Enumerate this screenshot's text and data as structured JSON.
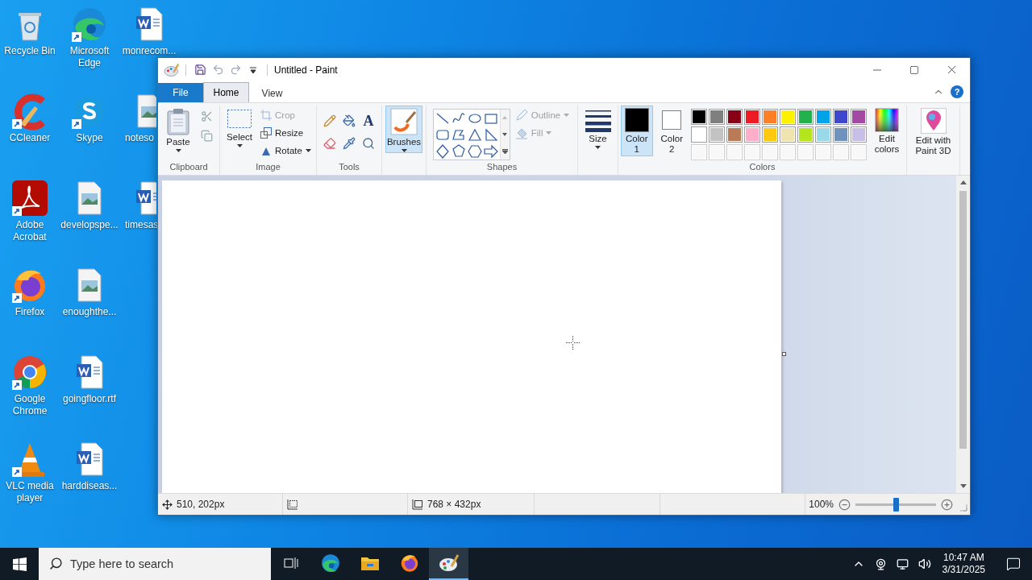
{
  "desktop": {
    "columns": [
      [
        {
          "label": "Recycle Bin",
          "kind": "recycle",
          "shortcut": false
        },
        {
          "label": "CCleaner",
          "kind": "ccleaner",
          "shortcut": true
        },
        {
          "label": "Adobe Acrobat",
          "kind": "acrobat",
          "shortcut": true
        },
        {
          "label": "Firefox",
          "kind": "firefox",
          "shortcut": true
        },
        {
          "label": "Google Chrome",
          "kind": "chrome",
          "shortcut": true
        },
        {
          "label": "VLC media player",
          "kind": "vlc",
          "shortcut": true
        }
      ],
      [
        {
          "label": "Microsoft Edge",
          "kind": "edge",
          "shortcut": true
        },
        {
          "label": "Skype",
          "kind": "skype",
          "shortcut": true
        },
        {
          "label": "developspe...",
          "kind": "image",
          "shortcut": false
        },
        {
          "label": "enoughthe...",
          "kind": "image",
          "shortcut": false
        },
        {
          "label": "goingfloor.rtf",
          "kind": "word",
          "shortcut": false
        },
        {
          "label": "harddiseas...",
          "kind": "word",
          "shortcut": false
        }
      ],
      [
        {
          "label": "monrecom...",
          "kind": "word",
          "shortcut": false
        },
        {
          "label": "noteso",
          "kind": "image",
          "shortcut": false
        },
        {
          "label": "timesas",
          "kind": "word",
          "shortcut": false
        }
      ]
    ]
  },
  "window": {
    "title": "Untitled - Paint",
    "help_glyph": "?"
  },
  "ribbon": {
    "tabs": [
      {
        "label": "File",
        "kind": "file"
      },
      {
        "label": "Home",
        "kind": "tab",
        "selected": true
      },
      {
        "label": "View",
        "kind": "tab",
        "selected": false
      }
    ],
    "clipboard": {
      "paste": "Paste",
      "label": "Clipboard"
    },
    "image": {
      "select": "Select",
      "crop": {
        "label": "Crop",
        "disabled": true
      },
      "resize": {
        "label": "Resize",
        "disabled": false
      },
      "rotate": {
        "label": "Rotate",
        "disabled": false
      },
      "label": "Image"
    },
    "tools": {
      "text_glyph": "A",
      "label": "Tools"
    },
    "brushes": {
      "label": "Brushes",
      "selected": true
    },
    "shapes": {
      "label": "Shapes",
      "outline": {
        "label": "Outline",
        "disabled": true
      },
      "fill": {
        "label": "Fill",
        "disabled": true
      }
    },
    "size": {
      "label": "Size"
    },
    "colors": {
      "label": "Colors",
      "color1": {
        "label": "Color 1",
        "color": "#000000",
        "selected": true
      },
      "color2": {
        "label": "Color 2",
        "color": "#ffffff",
        "selected": false
      },
      "palette": [
        {
          "kind": "swatch",
          "color": "#000000"
        },
        {
          "kind": "swatch",
          "color": "#7f7f7f"
        },
        {
          "kind": "swatch",
          "color": "#880015"
        },
        {
          "kind": "swatch",
          "color": "#ed1c24"
        },
        {
          "kind": "swatch",
          "color": "#ff7f27"
        },
        {
          "kind": "swatch",
          "color": "#fff200"
        },
        {
          "kind": "swatch",
          "color": "#22b14c"
        },
        {
          "kind": "swatch",
          "color": "#00a2e8"
        },
        {
          "kind": "swatch",
          "color": "#3f48cc"
        },
        {
          "kind": "swatch",
          "color": "#a349a4"
        },
        {
          "kind": "swatch",
          "color": "#ffffff"
        },
        {
          "kind": "swatch",
          "color": "#c3c3c3"
        },
        {
          "kind": "swatch",
          "color": "#b97a57"
        },
        {
          "kind": "swatch",
          "color": "#ffaec9"
        },
        {
          "kind": "swatch",
          "color": "#ffc90e"
        },
        {
          "kind": "swatch",
          "color": "#efe4b0"
        },
        {
          "kind": "swatch",
          "color": "#b5e61d"
        },
        {
          "kind": "swatch",
          "color": "#99d9ea"
        },
        {
          "kind": "swatch",
          "color": "#7092be"
        },
        {
          "kind": "swatch",
          "color": "#c8bfe7"
        },
        {
          "kind": "empty"
        },
        {
          "kind": "empty"
        },
        {
          "kind": "empty"
        },
        {
          "kind": "empty"
        },
        {
          "kind": "empty"
        },
        {
          "kind": "empty"
        },
        {
          "kind": "empty"
        },
        {
          "kind": "empty"
        },
        {
          "kind": "empty"
        },
        {
          "kind": "empty"
        }
      ],
      "edit_colors": "Edit colors"
    },
    "paint3d": "Edit with Paint 3D"
  },
  "status_bar": {
    "position": "510, 202px",
    "canvas_size": "768 × 432px",
    "zoom": "100%",
    "zoom_slider": {
      "level": 0.5
    }
  },
  "taskbar": {
    "search": {
      "placeholder": "Type here to search"
    },
    "apps": [
      {
        "kind": "taskview",
        "selected": false
      },
      {
        "kind": "edge",
        "selected": false
      },
      {
        "kind": "explorer",
        "selected": false
      },
      {
        "kind": "firefox",
        "selected": false
      },
      {
        "kind": "paint",
        "selected": true
      }
    ],
    "time": "10:47 AM",
    "date": "3/31/2025"
  }
}
